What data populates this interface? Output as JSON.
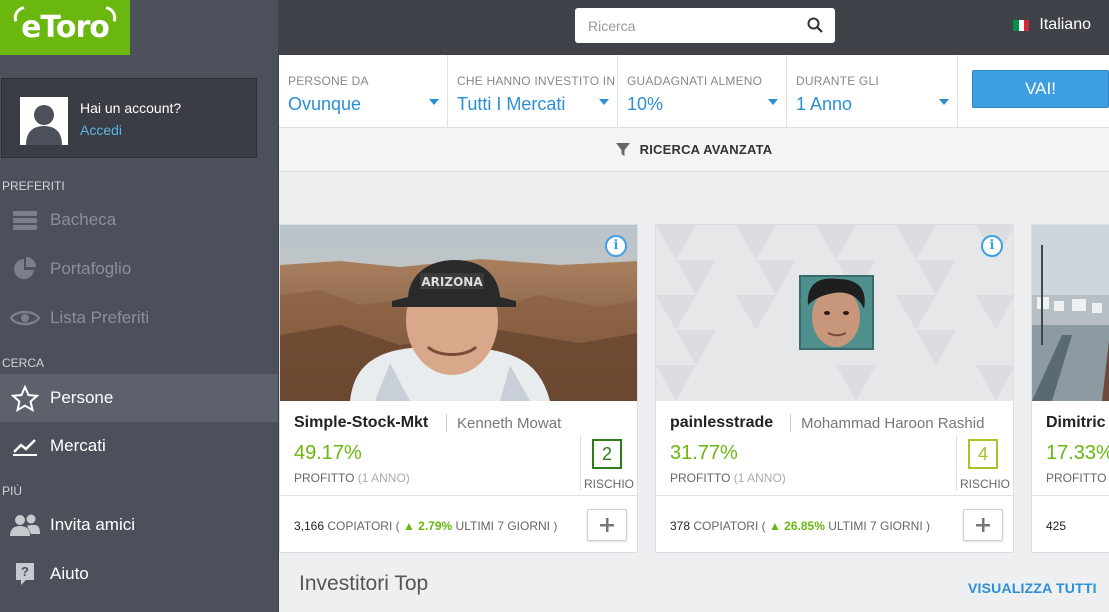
{
  "app": {
    "logo": "eToro"
  },
  "header": {
    "search_placeholder": "Ricerca",
    "language": "Italiano"
  },
  "sidebar": {
    "account": {
      "question": "Hai un account?",
      "login": "Accedi"
    },
    "sections": [
      {
        "label": "PREFERITI"
      },
      {
        "label": "CERCA"
      },
      {
        "label": "PIÙ"
      }
    ],
    "items": [
      {
        "label": "Bacheca",
        "icon": "dashboard-icon",
        "state": "disabled"
      },
      {
        "label": "Portafoglio",
        "icon": "pie-chart-icon",
        "state": "disabled"
      },
      {
        "label": "Lista Preferiti",
        "icon": "eye-icon",
        "state": "disabled"
      },
      {
        "label": "Persone",
        "icon": "star-icon",
        "state": "active"
      },
      {
        "label": "Mercati",
        "icon": "trend-chart-icon",
        "state": "normal"
      },
      {
        "label": "Invita amici",
        "icon": "users-icon",
        "state": "normal"
      },
      {
        "label": "Aiuto",
        "icon": "help-icon",
        "state": "normal"
      }
    ]
  },
  "filters": [
    {
      "label": "PERSONE DA",
      "value": "Ovunque"
    },
    {
      "label": "CHE HANNO INVESTITO IN",
      "value": "Tutti I Mercati"
    },
    {
      "label": "GUADAGNATI ALMENO",
      "value": "10%"
    },
    {
      "label": "DURANTE GLI",
      "value": "1 Anno"
    }
  ],
  "go_button": "VAI!",
  "advanced_search": "RICERCA AVANZATA",
  "cards": [
    {
      "username": "Simple-Stock-Mkt",
      "fullname": "Kenneth Mowat",
      "gain": "49.17%",
      "gain_label": "PROFITTO",
      "gain_period": "(1 ANNO)",
      "risk": "2",
      "risk_color": "#2e7d1a",
      "risk_label": "RISCHIO",
      "copiers": "3,166",
      "copiers_label": "COPIATORI (",
      "copiers_change": "2.79%",
      "copiers_suffix": "ULTIMI 7 GIORNI )"
    },
    {
      "username": "painlesstrade",
      "fullname": "Mohammad Haroon Rashid",
      "gain": "31.77%",
      "gain_label": "PROFITTO",
      "gain_period": "(1 ANNO)",
      "risk": "4",
      "risk_color": "#a8c22a",
      "risk_label": "RISCHIO",
      "copiers": "378",
      "copiers_label": "COPIATORI (",
      "copiers_change": "26.85%",
      "copiers_suffix": "ULTIMI 7 GIORNI )"
    },
    {
      "username": "Dimitric",
      "gain": "17.33%",
      "gain_label": "PROFITTO",
      "copiers": "425"
    }
  ],
  "section_title": "Investitori Top",
  "see_all": "VISUALIZZA TUTTI",
  "colors": {
    "brand_green": "#6ab70f",
    "accent_blue": "#3d9ee0",
    "sidebar": "#4b505a"
  }
}
